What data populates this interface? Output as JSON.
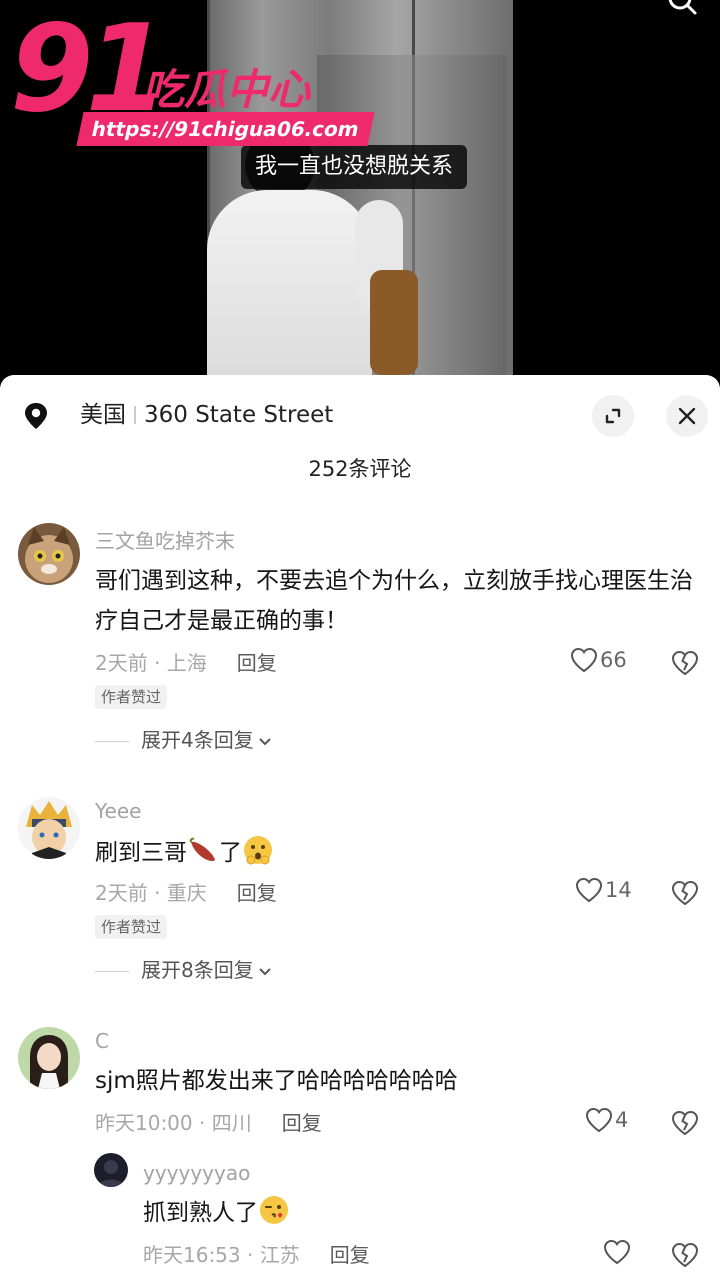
{
  "video": {
    "subtitle": "我一直也没想脱关系"
  },
  "watermark": {
    "number": "91",
    "name": "吃瓜中心",
    "url": "https://91chigua06.com"
  },
  "location": {
    "country": "美国",
    "place": "360 State Street"
  },
  "comments_count": "252条评论",
  "comments": [
    {
      "user": "三文鱼吃掉芥末",
      "text": "哥们遇到这种，不要去追个为什么，立刻放手找心理医生治疗自己才是最正确的事！",
      "meta": "2天前 · 上海",
      "reply_label": "回复",
      "likes": "66",
      "tag": "作者赞过",
      "expand": "展开4条回复"
    },
    {
      "user": "Yeee",
      "text_before": "刷到三哥",
      "text_after": "了",
      "meta": "2天前 · 重庆",
      "reply_label": "回复",
      "likes": "14",
      "tag": "作者赞过",
      "expand": "展开8条回复"
    },
    {
      "user": "C",
      "text": "sjm照片都发出来了哈哈哈哈哈哈哈",
      "meta": "昨天10:00 · 四川",
      "reply_label": "回复",
      "likes": "4"
    }
  ],
  "reply": {
    "user": "yyyyyyyao",
    "text": "抓到熟人了",
    "meta": "昨天16:53 · 江苏",
    "reply_label": "回复"
  },
  "icons": {
    "location": "location-pin-icon",
    "expand": "expand-icon",
    "close": "close-icon",
    "like": "heart-icon",
    "dislike": "broken-heart-icon"
  },
  "colors": {
    "brand": "#ee2a6c",
    "meta": "#a7a7a7"
  }
}
